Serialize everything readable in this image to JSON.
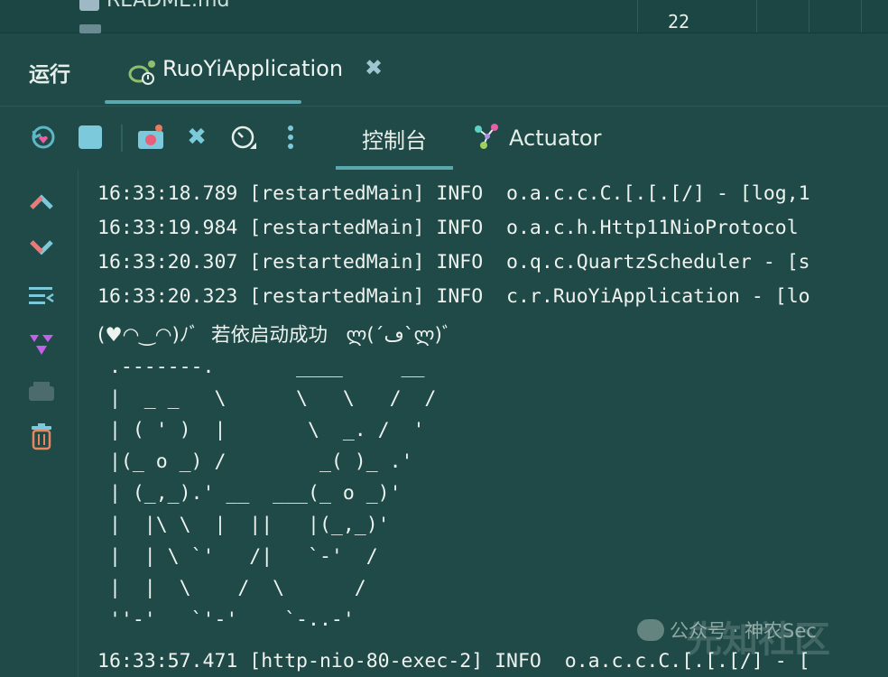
{
  "top": {
    "file_name": "README.md",
    "line_number": "22"
  },
  "run": {
    "label": "运行",
    "tab_label": "RuoYiApplication"
  },
  "toolbar": {
    "console_tab": "控制台",
    "actuator_tab": "Actuator",
    "icons": [
      "rerun-icon",
      "stop-icon",
      "camera-icon",
      "close-icon",
      "profiler-icon",
      "more-icon"
    ]
  },
  "gutter": {
    "icons": [
      "scroll-up-icon",
      "scroll-down-icon",
      "soft-wrap-icon",
      "filter-icon",
      "print-icon",
      "trash-icon"
    ]
  },
  "console": {
    "lines": [
      "16:33:18.789 [restartedMain] INFO  o.a.c.c.C.[.[.[/] - [log,1",
      "16:33:19.984 [restartedMain] INFO  o.a.c.h.Http11NioProtocol ",
      "16:33:20.307 [restartedMain] INFO  o.q.c.QuartzScheduler - [s",
      "16:33:20.323 [restartedMain] INFO  c.r.RuoYiApplication - [lo",
      "(♥◠‿◠)ﾉﾞ  若依启动成功   ლ(´ڡ`ლ)ﾞ",
      " .-------.       ____     __",
      " |  _ _   \\      \\   \\   /  /",
      " | ( ' )  |       \\  _. /  '",
      " |(_ o _) /        _( )_ .'",
      " | (_,_).' __  ___(_ o _)'",
      " |  |\\ \\  |  ||   |(_,_)'",
      " |  | \\ `'   /|   `-'  /",
      " |  |  \\    /  \\      /",
      " ''-'   `'-'    `-..-'",
      "16:33:57.471 [http-nio-80-exec-2] INFO  o.a.c.c.C.[.[.[/] - ["
    ]
  },
  "watermark": {
    "text": "公众号 · 神农Sec",
    "site": "先知社区"
  },
  "colors": {
    "background": "#1f4a47",
    "accent": "#5aa7ad",
    "text": "#eef3f0"
  }
}
